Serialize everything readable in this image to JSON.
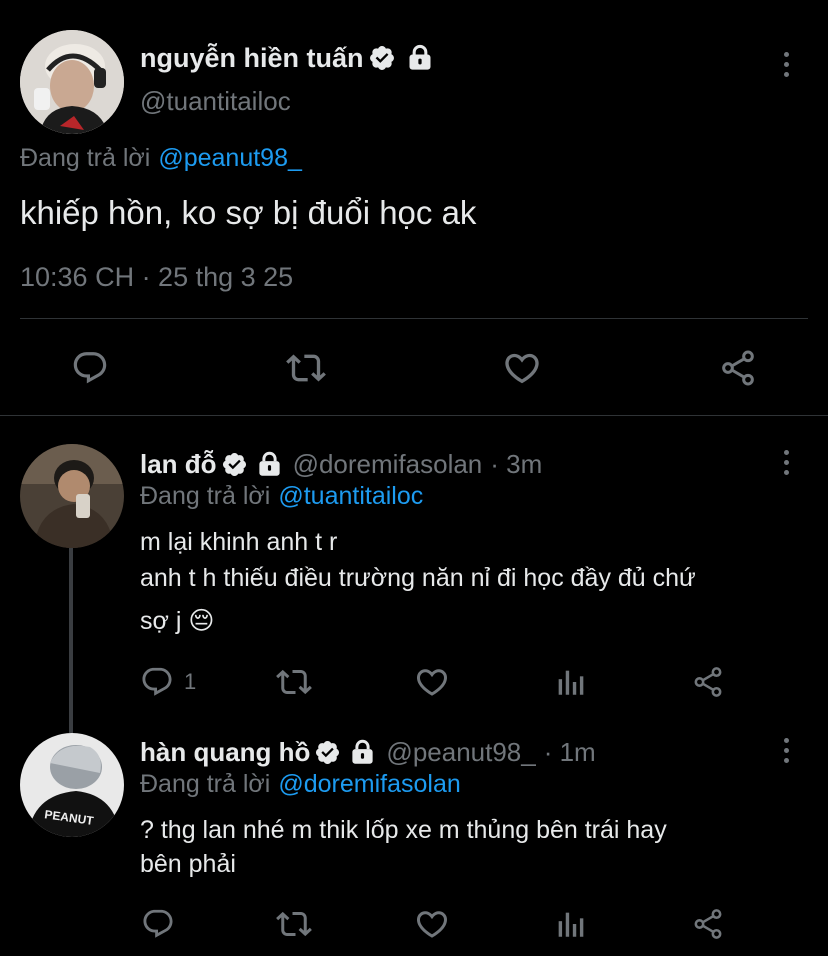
{
  "main_tweet": {
    "author_name": "nguyễn hiền tuấn",
    "handle": "@tuantitailoc",
    "replying_prefix": "Đang trả lời",
    "replying_to": "@peanut98_",
    "text": "khiếp hồn, ko sợ bị đuổi học ak",
    "timestamp": "10:36 CH · 25 thg 3 25"
  },
  "replies": [
    {
      "author_name": "lan đỗ",
      "handle": "@doremifasolan",
      "time": "· 3m",
      "replying_prefix": "Đang trả lời",
      "replying_to": "@tuantitailoc",
      "line1": "m lại khinh anh t r",
      "line2": "anh t h thiếu điều trường năn nỉ đi học đầy đủ chứ",
      "line3": "sợ j 😔",
      "reply_count": "1"
    },
    {
      "author_name": "hàn quang hồ",
      "handle": "@peanut98_",
      "time": "· 1m",
      "replying_prefix": "Đang trả lời",
      "replying_to": "@doremifasolan",
      "line1": "? thg lan nhé m thik lốp xe m thủng bên trái hay",
      "line2": "bên phải",
      "shirt_text": "PEANUT"
    }
  ],
  "colors": {
    "background": "#000000",
    "text": "#e7e9ea",
    "muted": "#71767b",
    "link": "#1d9bf0",
    "divider": "#2f3336"
  }
}
